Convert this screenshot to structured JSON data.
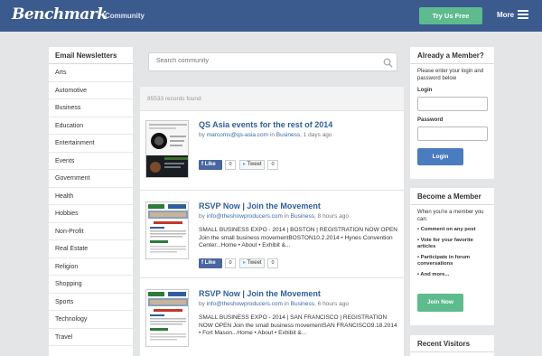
{
  "header": {
    "logo": "Benchmark",
    "community": "Community",
    "try_button": "Try Us Free",
    "more": "More"
  },
  "sidebar": {
    "title": "Email Newsletters",
    "items": [
      "Arts",
      "Automotive",
      "Business",
      "Education",
      "Entertainment",
      "Events",
      "Government",
      "Health",
      "Hobbies",
      "Non-Profit",
      "Real Estate",
      "Religion",
      "Shopping",
      "Sports",
      "Technology",
      "Travel"
    ]
  },
  "search": {
    "placeholder": "Search community"
  },
  "records": "85533 records found",
  "posts": [
    {
      "title": "QS Asia events for the rest of 2014",
      "by": "by",
      "author": "marcoms@qs-asia.com",
      "in": "in",
      "category": "Business",
      "time": ", 1 days ago",
      "body": "",
      "like": "Like",
      "like_count": "0",
      "tweet": "Tweet",
      "tweet_count": "0"
    },
    {
      "title": "RSVP Now | Join the Movement",
      "by": "by",
      "author": "info@theshowproducers.com",
      "in": "in",
      "category": "Business",
      "time": ", 8 hours ago",
      "body": "SMALL BUSINESS EXPO - 2014 | BOSTON | REGISTRATION NOW OPEN Join the small business movementBOSTON10.2.2014 • Hynes Convention Center...Home • About • Exhibit &...",
      "like": "Like",
      "like_count": "0",
      "tweet": "Tweet",
      "tweet_count": "0"
    },
    {
      "title": "RSVP Now | Join the Movement",
      "by": "by",
      "author": "info@theshowproducers.com",
      "in": "in",
      "category": "Business",
      "time": ", 6 hours ago",
      "body": "SMALL BUSINESS EXPO - 2014 | SAN FRANCISCO | REGISTRATION NOW OPEN Join the small business movementSAN FRANCISCO9.18.2014 • Fort Mason...Home • About • Exhibit &...",
      "like": "Like",
      "like_count": "0",
      "tweet": "Tweet",
      "tweet_count": "0"
    }
  ],
  "member": {
    "title": "Already a Member?",
    "text": "Please enter your login and password below",
    "login_label": "Login",
    "password_label": "Password",
    "login_button": "Login"
  },
  "become": {
    "title": "Become a Member",
    "text": "When you're a member you can:",
    "benefits": [
      "• Comment on any post",
      "• Vote for your favorite articles",
      "• Participate in forum conversations",
      "• And more..."
    ],
    "join_button": "Join Now"
  },
  "visitors": {
    "title": "Recent Visitors"
  },
  "colors": {
    "header_bg": "#3b5a8e",
    "accent_green": "#5dbb8e",
    "link_blue": "#2e5f9a",
    "login_blue": "#4a7cbf",
    "page_bg": "#e4e5e7"
  }
}
